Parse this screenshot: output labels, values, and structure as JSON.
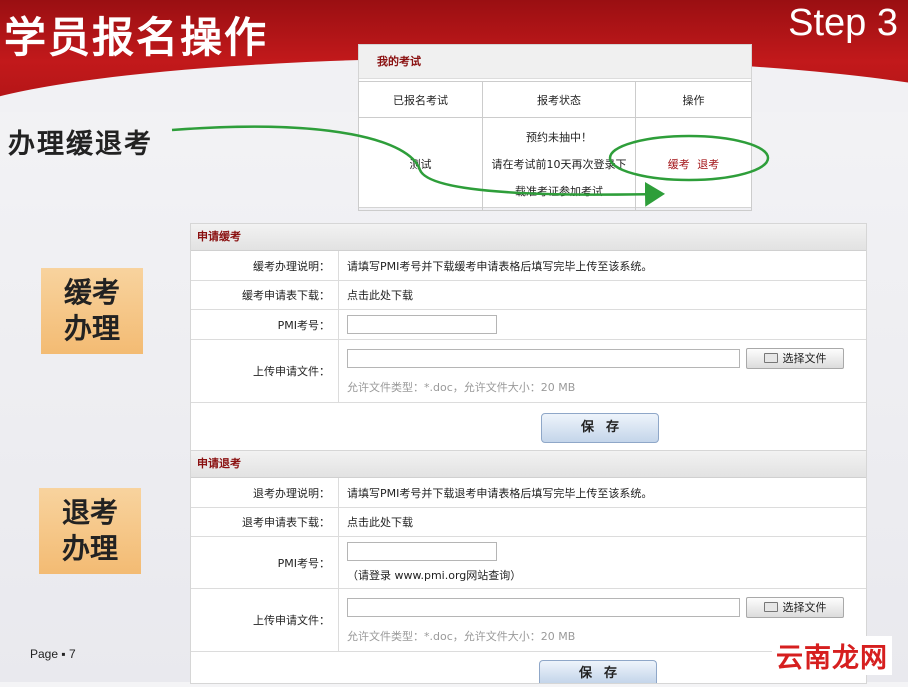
{
  "slide": {
    "title": "学员报名操作",
    "step": "Step 3",
    "callout": "办理缓退考",
    "side_defer": "缓考办理",
    "side_withdraw": "退考办理",
    "page_number": "Page ▪ 7",
    "watermark": "云南龙网"
  },
  "exam_panel": {
    "title": "我的考试",
    "columns": [
      "已报名考试",
      "报考状态",
      "操作"
    ],
    "row": {
      "exam": "测试",
      "status_lines": [
        "预约未抽中！",
        "请在考试前10天再次登录下",
        "载准考证参加考试"
      ],
      "action_defer": "缓考",
      "action_withdraw": "退考"
    }
  },
  "defer_form": {
    "title": "申请缓考",
    "desc_label": "缓考办理说明：",
    "desc_value": "请填写PMI考号并下载缓考申请表格后填写完毕上传至该系统。",
    "download_label": "缓考申请表下载：",
    "download_link": "点击此处下载",
    "pmi_label": "PMI考号：",
    "pmi_value": "",
    "upload_label": "上传申请文件：",
    "file_value": "",
    "choose_button": "选择文件",
    "hint": "允许文件类型：*.doc，允许文件大小：20 MB",
    "save_button": "保存"
  },
  "withdraw_form": {
    "title": "申请退考",
    "desc_label": "退考办理说明：",
    "desc_value": "请填写PMI考号并下载退考申请表格后填写完毕上传至该系统。",
    "download_label": "退考申请表下载：",
    "download_link": "点击此处下载",
    "pmi_label": "PMI考号：",
    "pmi_value": "",
    "pmi_note": "（请登录 www.pmi.org网站查询）",
    "upload_label": "上传申请文件：",
    "file_value": "",
    "choose_button": "选择文件",
    "hint": "允许文件类型：*.doc，允许文件大小：20 MB",
    "save_button": "保存"
  },
  "colors": {
    "brand_red": "#c2191b",
    "annotation_green": "#2e9e3a",
    "heading_red": "#8a1010",
    "side_box": "#f6c789"
  }
}
